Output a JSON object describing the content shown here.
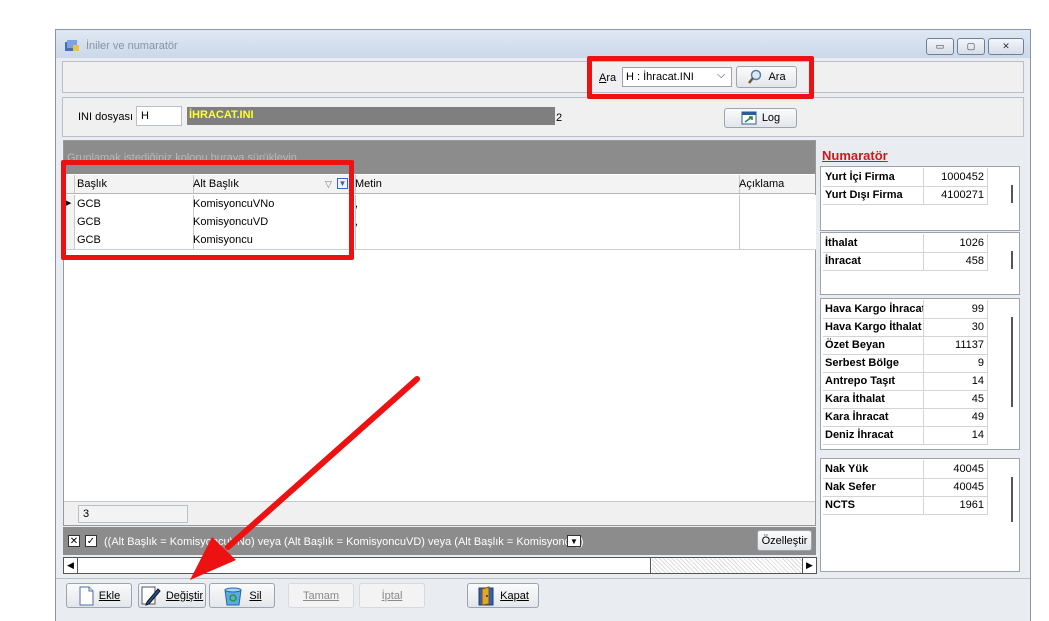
{
  "window": {
    "title": "İniler ve numaratör",
    "minimize": "▭",
    "maximize": "▢",
    "close": "✕"
  },
  "search": {
    "label": "Ara",
    "accesskey_label": "A",
    "label_rest": "ra",
    "combo_value": "H : İhracat.INI",
    "button_label": "Ara"
  },
  "ini": {
    "label": "INI dosyası",
    "code": "H",
    "name": "İHRACAT.INI",
    "marker": "2",
    "log_label": "Log"
  },
  "grid": {
    "group_hint": "Gruplamak istediğiniz kolonu buraya sürükleyin",
    "columns": [
      "Başlık",
      "Alt Başlık",
      "Metin",
      "Açıklama"
    ],
    "rows": [
      {
        "baslik": "GCB",
        "alt": "KomisyoncuVNo",
        "metin": ",",
        "aciklama": ""
      },
      {
        "baslik": "GCB",
        "alt": "KomisyoncuVD",
        "metin": ",",
        "aciklama": ""
      },
      {
        "baslik": "GCB",
        "alt": "Komisyoncu",
        "metin": "",
        "aciklama": ""
      }
    ],
    "count": "3",
    "filter_text": "((Alt Başlık = KomisyoncuVNo) veya (Alt Başlık = KomisyoncuVD) veya (Alt Başlık = Komisyoncu))",
    "customize_label": "Özelleştir"
  },
  "numarator": {
    "title": "Numaratör",
    "groups": [
      {
        "rows": [
          {
            "label": "Yurt İçi Firma",
            "value": "1000452"
          },
          {
            "label": "Yurt Dışı Firma",
            "value": "4100271"
          }
        ]
      },
      {
        "rows": [
          {
            "label": "İthalat",
            "value": "1026"
          },
          {
            "label": "İhracat",
            "value": "458"
          }
        ]
      },
      {
        "rows": [
          {
            "label": "Hava Kargo İhracat",
            "value": "99"
          },
          {
            "label": "Hava Kargo İthalat",
            "value": "30"
          },
          {
            "label": "Özet Beyan",
            "value": "11137"
          },
          {
            "label": "Serbest Bölge",
            "value": "9"
          },
          {
            "label": "Antrepo Taşıt",
            "value": "14"
          },
          {
            "label": "Kara İthalat",
            "value": "45"
          },
          {
            "label": "Kara İhracat",
            "value": "49"
          },
          {
            "label": "Deniz İhracat",
            "value": "14"
          }
        ]
      },
      {
        "rows": [
          {
            "label": "Nak Yük",
            "value": "40045"
          },
          {
            "label": "Nak Sefer",
            "value": "40045"
          },
          {
            "label": "NCTS",
            "value": "1961"
          }
        ]
      }
    ]
  },
  "toolbar": {
    "ekle": "Ekle",
    "degistir": "Değiştir",
    "sil": "Sil",
    "tamam": "Tamam",
    "iptal": "İptal",
    "kapat": "Kapat"
  },
  "colors": {
    "highlight": "#ee1111",
    "ini_name_bg": "#7f7f7f",
    "ini_name_fg": "#ffff33",
    "group_area_bg": "#8c8c8c"
  }
}
